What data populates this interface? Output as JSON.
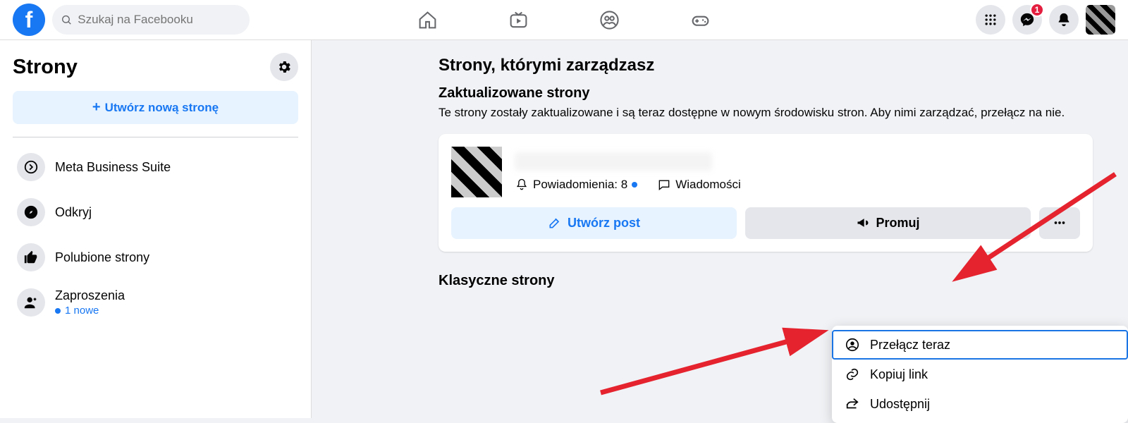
{
  "search": {
    "placeholder": "Szukaj na Facebooku"
  },
  "notifications_badge": "1",
  "sidebar": {
    "title": "Strony",
    "create_label": "Utwórz nową stronę",
    "items": [
      {
        "label": "Meta Business Suite"
      },
      {
        "label": "Odkryj"
      },
      {
        "label": "Polubione strony"
      },
      {
        "label": "Zaproszenia",
        "sub": "1 nowe"
      }
    ]
  },
  "main": {
    "title": "Strony, którymi zarządzasz",
    "updated_h": "Zaktualizowane strony",
    "updated_desc": "Te strony zostały zaktualizowane i są teraz dostępne w nowym środowisku stron. Aby nimi zarządzać, przełącz na nie.",
    "classic_h": "Klasyczne strony",
    "page_card": {
      "notif_label": "Powiadomienia: 8",
      "messages_label": "Wiadomości",
      "create_post": "Utwórz post",
      "promote": "Promuj"
    }
  },
  "popup": {
    "switch": "Przełącz teraz",
    "copy": "Kopiuj link",
    "share": "Udostępnij"
  }
}
